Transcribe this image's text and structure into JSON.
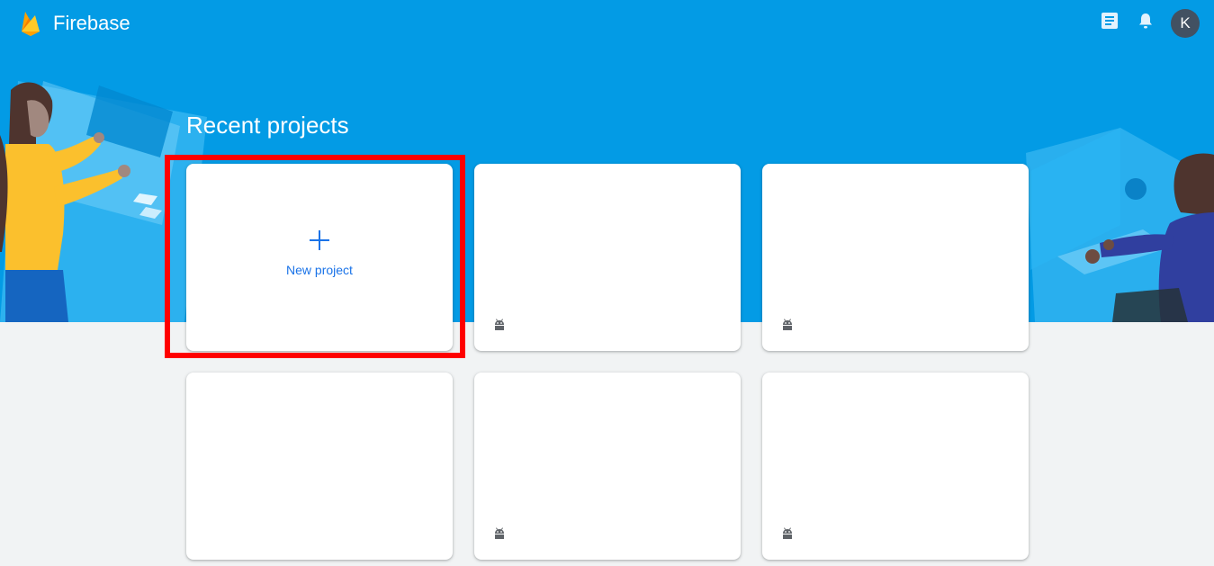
{
  "header": {
    "app_title": "Firebase",
    "icons": {
      "logo": "firebase-flame-icon",
      "docs": "docs-icon",
      "notifications": "bell-icon"
    },
    "avatar_initial": "K"
  },
  "main": {
    "section_title": "Recent projects",
    "new_project_label": "New project",
    "projects": [
      {
        "name": "",
        "platform_icon": "android-icon"
      },
      {
        "name": "",
        "platform_icon": "android-icon"
      },
      {
        "name": "",
        "platform_icon": ""
      },
      {
        "name": "",
        "platform_icon": "android-icon"
      },
      {
        "name": "",
        "platform_icon": "android-icon"
      }
    ]
  },
  "colors": {
    "hero_blue": "#039be5",
    "page_background": "#f1f3f4",
    "accent_blue": "#1a73e8",
    "highlight_red": "#ff0000",
    "avatar_background": "#425162"
  }
}
